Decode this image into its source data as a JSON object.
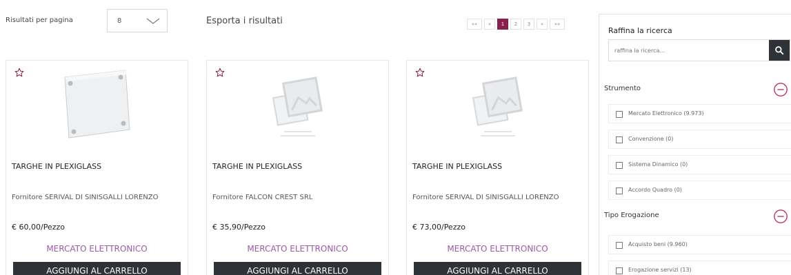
{
  "toolbar": {
    "results_per_page_label": "Risultati per pagina",
    "results_per_page_value": "8",
    "export_label": "Esporta i risultati"
  },
  "pagination": {
    "first": "««",
    "prev": "«",
    "pages": [
      "1",
      "2",
      "3"
    ],
    "active_page": "1",
    "next": "»",
    "last": "»»"
  },
  "products": [
    {
      "title": "TARGHE IN PLEXIGLASS",
      "supplier": "Fornitore SERIVAL DI SINISGALLI LORENZO",
      "price": "€ 60,00/Pezzo",
      "channel": "MERCATO ELETTRONICO",
      "cart_label": "AGGIUNGI AL CARRELLO",
      "image": "plexiglass-sign-photo"
    },
    {
      "title": "TARGHE IN PLEXIGLASS",
      "supplier": "Fornitore FALCON CREST SRL",
      "price": "€ 35,90/Pezzo",
      "channel": "MERCATO ELETTRONICO",
      "cart_label": "AGGIUNGI AL CARRELLO",
      "image": "image-placeholder-icon"
    },
    {
      "title": "TARGHE IN PLEXIGLASS",
      "supplier": "Fornitore SERIVAL DI SINISGALLI LORENZO",
      "price": "€ 73,00/Pezzo",
      "channel": "MERCATO ELETTRONICO",
      "cart_label": "AGGIUNGI AL CARRELLO",
      "image": "image-placeholder-icon"
    }
  ],
  "sidebar": {
    "title": "Raffina la ricerca",
    "search_placeholder": "raffina la ricerca...",
    "groups": [
      {
        "title": "Strumento",
        "items": [
          {
            "label": "Mercato Elettronico (9.973)",
            "color": "#9b59a6"
          },
          {
            "label": "Convenzione (0)",
            "color": "#a8c64a"
          },
          {
            "label": "Sistema Dinamico (0)",
            "color": "#2aa3a0"
          },
          {
            "label": "Accordo Quadro (0)",
            "color": "#c0335e"
          }
        ]
      },
      {
        "title": "Tipo Erogazione",
        "items": [
          {
            "label": "Acquisto beni (9.960)"
          },
          {
            "label": "Erogazione servizi (13)"
          }
        ]
      }
    ]
  },
  "colors": {
    "accent": "#8a1f4e",
    "channel": "#9b5aa6",
    "button_dark": "#2f3236",
    "toggle": "#c0335e"
  }
}
